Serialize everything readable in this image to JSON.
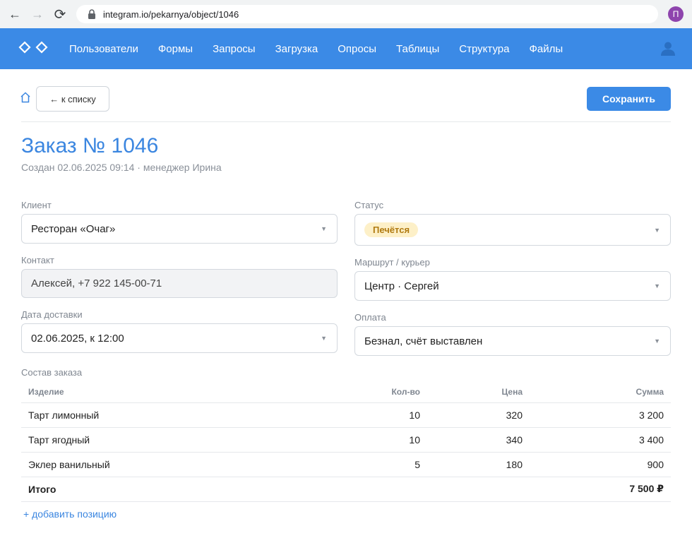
{
  "browser": {
    "url": "integram.io/pekarnya/object/1046",
    "profile_initial": "П"
  },
  "header": {
    "menu": [
      "Пользователи",
      "Формы",
      "Запросы",
      "Загрузка",
      "Опросы",
      "Таблицы",
      "Структура",
      "Файлы"
    ]
  },
  "toolbar": {
    "back_label": "← к списку",
    "save_label": "Сохранить"
  },
  "order": {
    "title": "Заказ № 1046",
    "meta": "Создан 02.06.2025 09:14 · менеджер Ирина"
  },
  "form": {
    "client": {
      "label": "Клиент",
      "value": "Ресторан «Очаг»"
    },
    "contact": {
      "label": "Контакт",
      "value": "Алексей, +7 922 145-00-71"
    },
    "delivery_date": {
      "label": "Дата доставки",
      "value": "02.06.2025, к 12:00"
    },
    "status": {
      "label": "Статус",
      "value": "Печётся",
      "color": "#fdf0c8"
    },
    "route": {
      "label": "Маршрут / курьер",
      "value": "Центр · Сергей"
    },
    "payment": {
      "label": "Оплата",
      "value": "Безнал, счёт выставлен"
    }
  },
  "items": {
    "section_label": "Состав заказа",
    "headers": {
      "product": "Изделие",
      "qty": "Кол-во",
      "price": "Цена",
      "sum": "Сумма"
    },
    "rows": [
      {
        "product": "Тарт лимонный",
        "qty": "10",
        "price": "320",
        "sum": "3 200"
      },
      {
        "product": "Тарт ягодный",
        "qty": "10",
        "price": "340",
        "sum": "3 400"
      },
      {
        "product": "Эклер ванильный",
        "qty": "5",
        "price": "180",
        "sum": "900"
      }
    ],
    "total_label": "Итого",
    "total_value": "7 500 ₽",
    "add_label": "+ добавить позицию"
  },
  "colors": {
    "accent": "#3b8ae6",
    "title": "#3b86e0"
  }
}
